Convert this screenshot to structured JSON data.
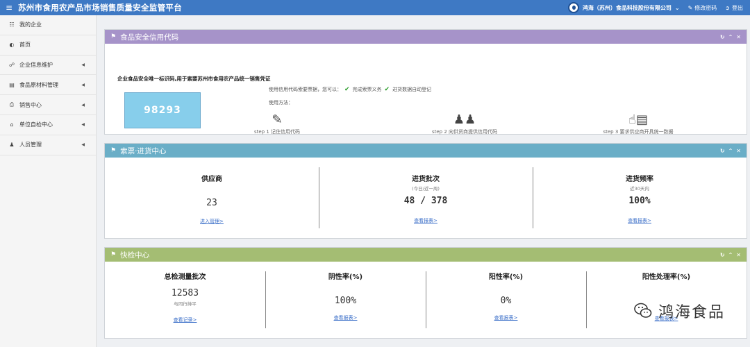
{
  "header": {
    "title": "苏州市食用农产品市场销售质量安全监管平台",
    "menu_icon": "menu-icon",
    "user": "鸿海（苏州）食品科技股份有限公司",
    "change_password": "修改密码",
    "logout": "登出"
  },
  "sidebar": {
    "items": [
      {
        "label": "我的企业",
        "icon": "sitemap-icon"
      },
      {
        "label": "首页",
        "icon": "dashboard-icon"
      },
      {
        "label": "企业信息维护",
        "icon": "bookmark-icon"
      },
      {
        "label": "食品原材料管理",
        "icon": "file-icon"
      },
      {
        "label": "销售中心",
        "icon": "print-icon"
      },
      {
        "label": "单位自检中心",
        "icon": "home-icon"
      },
      {
        "label": "人员管理",
        "icon": "users-icon"
      }
    ]
  },
  "colors": {
    "topbar": "#3e79c4",
    "credit_head": "#a693c9",
    "purchase_head": "#6aaec7",
    "inspect_head": "#a4bd73"
  },
  "credit": {
    "title": "食品安全信用代码",
    "description": "企业食品安全唯一标识码,用于索要苏州市食用农产品统一销售凭证",
    "code": "98293",
    "usage_intro": "使用信用代码索要票据，您可以：",
    "usage_item1": "完成索票义务",
    "usage_item2": "进货数据自动登记",
    "method_label": "使用方法：",
    "steps": [
      {
        "label": "step 1 记住信用代码",
        "icon": "edit-icon"
      },
      {
        "label": "step 2 向供货商提供信用代码",
        "icon": "users-chat-icon"
      },
      {
        "label": "step 3 要求供应商开具统一数据",
        "icon": "thumbs-document-icon"
      }
    ]
  },
  "purchase": {
    "title": "索票·进货中心",
    "stats": [
      {
        "label": "供应商",
        "sub": "",
        "value": "23",
        "link": "进入管理>"
      },
      {
        "label": "进货批次",
        "sub": "(今日/近一周)",
        "value": "48 / 378",
        "link": "查看报表>"
      },
      {
        "label": "进货频率",
        "sub": "近30天内",
        "value": "100%",
        "link": "查看报表>"
      }
    ]
  },
  "inspect": {
    "title": "快检中心",
    "stats": [
      {
        "label": "总检测量批次",
        "value": "12583",
        "sub": "与同行持平",
        "link": "查看记录>"
      },
      {
        "label": "阴性率(%)",
        "value": "100%",
        "link": "查看报表>"
      },
      {
        "label": "阳性率(%)",
        "value": "0%",
        "link": "查看报表>"
      },
      {
        "label": "阳性处理率(%)",
        "value": "",
        "link": "查看报表>"
      }
    ]
  },
  "watermark": {
    "text": "鸿海食品"
  }
}
